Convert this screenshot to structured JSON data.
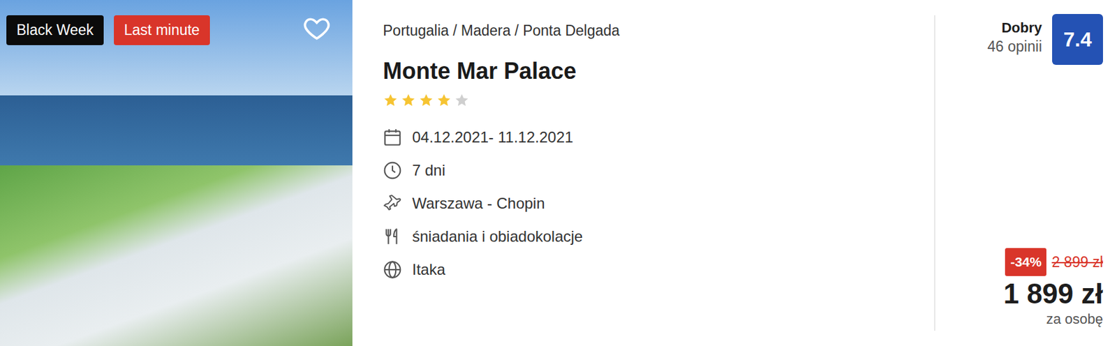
{
  "photo": {
    "badges": [
      {
        "label": "Black Week",
        "color": "#0b0b0b"
      },
      {
        "label": "Last minute",
        "color": "#d9352a"
      }
    ],
    "favorite": false
  },
  "breadcrumb": "Portugalia / Madera / Ponta Delgada",
  "title": "Monte Mar Palace",
  "stars": 4,
  "stars_max": 5,
  "details": [
    {
      "kind": "dates",
      "text": "04.12.2021- 11.12.2021"
    },
    {
      "kind": "duration",
      "text": "7 dni"
    },
    {
      "kind": "flight",
      "text": "Warszawa - Chopin"
    },
    {
      "kind": "board",
      "text": "śniadania i obiadokolacje"
    },
    {
      "kind": "operator",
      "text": "Itaka"
    }
  ],
  "rating": {
    "label": "Dobry",
    "reviews": "46 opinii",
    "score": "7.4"
  },
  "price": {
    "discount": "-34%",
    "old": "2 899 zł",
    "current": "1 899 zł",
    "note": "za osobę"
  }
}
